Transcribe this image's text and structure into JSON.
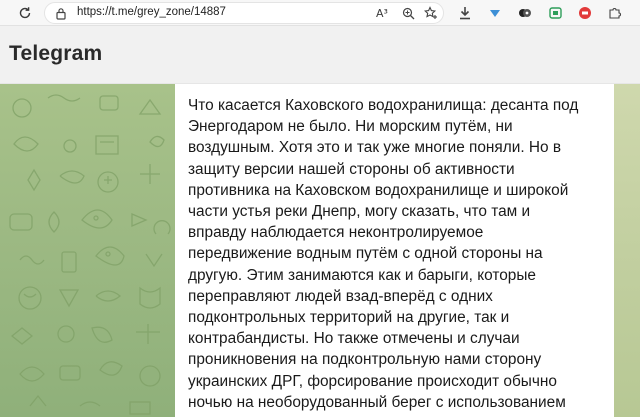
{
  "browser": {
    "url": "https://t.me/grey_zone/14887",
    "reader_label": "A³",
    "icons": [
      "refresh-icon",
      "lock-icon",
      "read-aloud-icon",
      "zoom-icon",
      "favorites-icon",
      "download-icon",
      "extension-icon",
      "wallet-icon",
      "extension-badge-icon"
    ]
  },
  "header": {
    "title": "Telegram"
  },
  "message": {
    "lines": [
      "Что касается Каховского водохранилища: десанта под",
      "Энергодаром не было. Ни морским путём, ни",
      "воздушным. Хотя это и так уже многие поняли. Но в",
      "защиту версии нашей стороны об активности",
      "противника на Каховском водохранилище и широкой",
      "части устья реки Днепр, могу сказать, что там и",
      "вправду наблюдается неконтролируемое",
      "передвижение водным путём с одной стороны на",
      "другую. Этим занимаются как и барыги, которые",
      "переправляют людей взад-вперёд с одних",
      "подконтрольных территорий на другие, так и",
      "контрабандисты. Но также отмечены и случаи",
      "проникновения на подконтрольную нами сторону",
      "украинских ДРГ, форсирование происходит обычно",
      "ночью на необорудованный берег с использованием"
    ]
  },
  "colors": {
    "background_green": "#9eba84",
    "header_bg": "#f1f1f1",
    "text": "#1a1a1a"
  }
}
